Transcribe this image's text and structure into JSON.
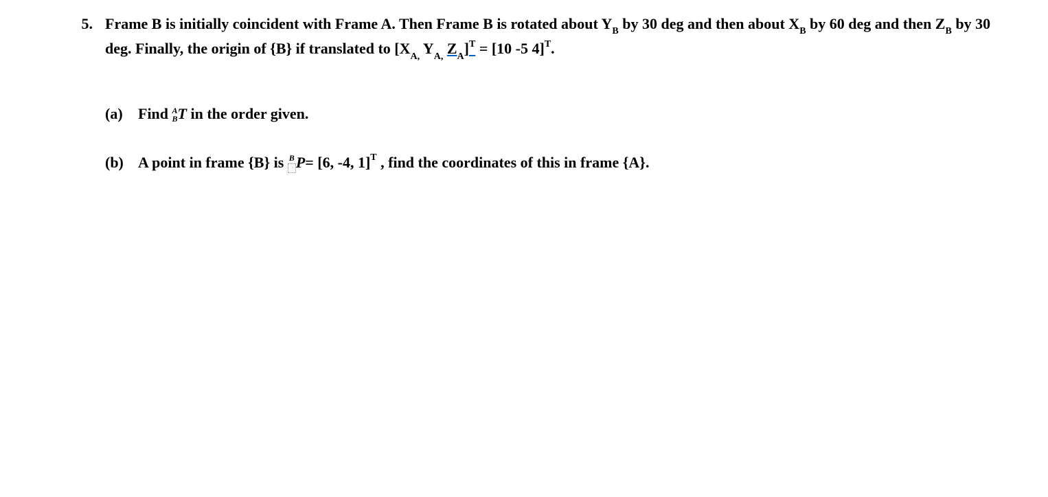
{
  "problem": {
    "number": "5.",
    "text_part1": "Frame B is initially coincident with Frame A. Then Frame B is rotated about Y",
    "sub_B1": "B",
    "text_part2": " by 30 deg and then about X",
    "sub_B2": "B",
    "text_part3": " by 60 deg and then Z",
    "sub_B3": "B",
    "text_part4": " by 30 deg. Finally, the origin of {B} if translated to [X",
    "sub_A1": "A,",
    "text_part5": " Y",
    "sub_A2": "A,",
    "text_part6": " ",
    "za_text": "Z",
    "sub_A3": "A",
    "za_bracket": "]",
    "sup_T1": "T",
    "text_part7": " = [10 -5 4]",
    "sup_T2": "T",
    "text_part8": "."
  },
  "part_a": {
    "label": "(a)",
    "text1": "Find  ",
    "frac_top": "A",
    "frac_bot": "B",
    "text_T": "T",
    "text2": " in the order given."
  },
  "part_b": {
    "label": "(b)",
    "text1": "A point in frame {B} is ",
    "sup_B": "B",
    "text_P": "P",
    "text2": "= [6, -4, 1]",
    "sup_T": "T",
    "text3": " , find the coordinates of this in frame {A}."
  }
}
